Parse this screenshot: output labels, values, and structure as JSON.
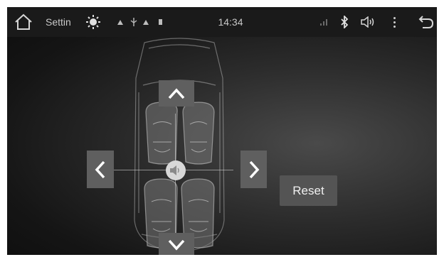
{
  "statusbar": {
    "home_icon": "home-icon",
    "app_title": "Settin",
    "brightness_icon": "brightness-icon",
    "time": "14:34",
    "signal_icon": "signal-icon",
    "bluetooth_icon": "bluetooth-icon",
    "volume_icon": "volume-icon",
    "menu_icon": "more-vert-icon",
    "back_icon": "back-arrow-icon"
  },
  "balance": {
    "up_icon": "chevron-up-icon",
    "down_icon": "chevron-down-icon",
    "left_icon": "chevron-left-icon",
    "right_icon": "chevron-right-icon",
    "speaker_icon": "speaker-icon",
    "reset_label": "Reset"
  },
  "colors": {
    "bar": "#1a1a1a",
    "button": "#5f5f5f",
    "reset": "#545454"
  }
}
